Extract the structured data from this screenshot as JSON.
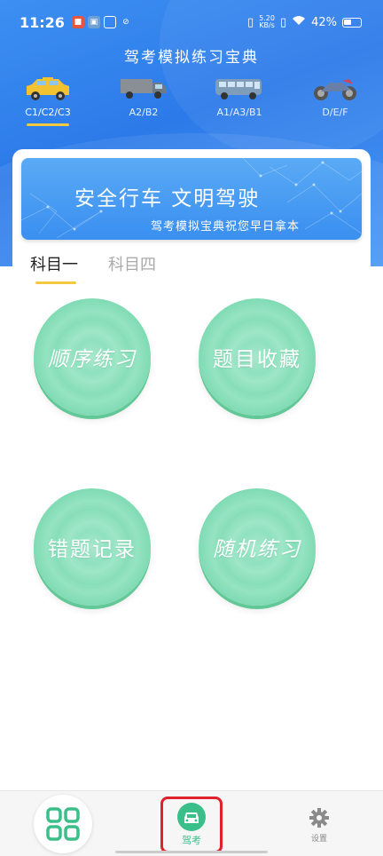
{
  "status_bar": {
    "time": "11:26",
    "net_speed_value": "5.20",
    "net_speed_unit": "KB/s",
    "battery": "42%"
  },
  "app": {
    "title": "驾考模拟练习宝典"
  },
  "vehicle_tabs": [
    {
      "label": "C1/C2/C3",
      "icon": "taxi-icon",
      "active": true
    },
    {
      "label": "A2/B2",
      "icon": "truck-icon",
      "active": false
    },
    {
      "label": "A1/A3/B1",
      "icon": "bus-icon",
      "active": false
    },
    {
      "label": "D/E/F",
      "icon": "motorcycle-icon",
      "active": false
    }
  ],
  "banner": {
    "title": "安全行车  文明驾驶",
    "subtitle": "驾考模拟宝典祝您早日拿本"
  },
  "subject_tabs": [
    {
      "label": "科目一",
      "active": true
    },
    {
      "label": "科目四",
      "active": false
    }
  ],
  "actions": {
    "sequential": "顺序练习",
    "favorites": "题目收藏",
    "mistakes": "错题记录",
    "random": "随机练习"
  },
  "bottom_nav": {
    "home_icon": "grid-icon",
    "center_label": "驾考",
    "center_icon": "car-icon",
    "settings_label": "设置",
    "settings_icon": "gear-icon"
  },
  "colors": {
    "header_blue": "#2c7ae9",
    "accent_yellow": "#f5c842",
    "button_green": "#74d4aa",
    "nav_green": "#3bbf8a",
    "highlight_red": "#e0202a"
  }
}
